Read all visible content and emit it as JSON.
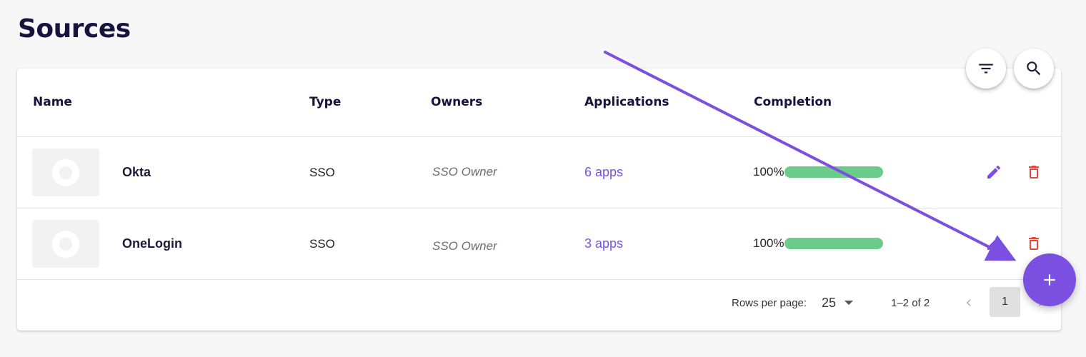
{
  "page": {
    "title": "Sources"
  },
  "table": {
    "columns": [
      "Name",
      "Type",
      "Owners",
      "Applications",
      "Completion"
    ],
    "rows": [
      {
        "name": "Okta",
        "type": "SSO",
        "owner": "SSO Owner",
        "apps": "6 apps",
        "completion_label": "100%",
        "completion": 1.0
      },
      {
        "name": "OneLogin",
        "type": "SSO",
        "owner": "SSO Owner",
        "apps": "3 apps",
        "completion_label": "100%",
        "completion": 1.0
      }
    ]
  },
  "pagination": {
    "rows_per_page_label": "Rows per page:",
    "rows_per_page": "25",
    "range": "1–2 of 2",
    "current_page": "1"
  },
  "icons": {
    "filter": "filter-icon",
    "search": "search-icon",
    "edit": "pencil-icon",
    "delete": "trash-icon",
    "add": "plus-icon",
    "prev": "chevron-left-icon",
    "next": "chevron-right-icon"
  },
  "colors": {
    "accent": "#7b4fe0",
    "progress": "#6bcb88",
    "danger": "#e0483b",
    "title": "#16133f"
  }
}
